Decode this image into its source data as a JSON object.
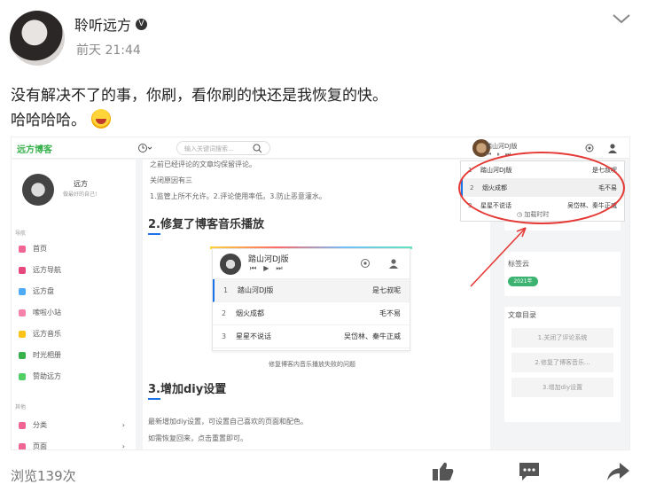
{
  "post": {
    "username": "聆听远方",
    "verified_glyph": "V",
    "time": "前天 21:44",
    "text_line1": "没有解决不了的事，你刷，看你刷的快还是我恢复的快。",
    "text_line2": "哈哈哈哈。",
    "views": "浏览139次",
    "icons": [
      "chevron-down-icon",
      "thumbs-up-icon",
      "comment-icon",
      "share-icon",
      "laughing-emoji-icon"
    ]
  },
  "shot": {
    "logo": "远方博客",
    "search_placeholder": "输入关键词搜索...",
    "blog_name": "远方",
    "blog_motto": "做最好的自己!",
    "nav_header": "导航",
    "nav": [
      "首页",
      "远方导航",
      "远方盘",
      "嗦啦小站",
      "远方音乐",
      "时光相册",
      "赞助远方"
    ],
    "nav_colors": [
      "#f06595",
      "#e64980",
      "#4dabf7",
      "#f783ac",
      "#fcc419",
      "#37b24d",
      "#51cf66"
    ],
    "other_header": "其他",
    "other": [
      "分类",
      "页面"
    ],
    "intro_line1": "之前已经评论的文章均保留评论。",
    "intro_line2": "关闭原因有三",
    "intro_line3": "1.监管上所不允许。2.评论使用率低。3.防止恶意灌水。",
    "h2_music": "2.修复了博客音乐播放",
    "h3_diy": "3.增加diy设置",
    "caption": "修复博客内音乐播放失败的问题",
    "diy_line1": "最新增加diy设置，可设置自己喜欢的页面和配色。",
    "diy_line2": "如需恢复回来，点击重置即可。",
    "player_title": "踏山河DJ版",
    "playlist": [
      {
        "n": "1",
        "title": "踏山河DJ版",
        "artist": "是七叔呢"
      },
      {
        "n": "2",
        "title": "烟火成都",
        "artist": "毛不易"
      },
      {
        "n": "3",
        "title": "星星不说话",
        "artist": "吴岱林、秦牛正威"
      }
    ],
    "popup_rows": [
      {
        "n": "1",
        "title": "踏山河DJ版",
        "artist": "是七叔呢"
      },
      {
        "n": "2",
        "title": "烟火成都",
        "artist": "毛不易"
      },
      {
        "n": "3",
        "title": "星星不说话",
        "artist": "吴岱林、秦牛正威"
      }
    ],
    "popup_header": "踏山河DJ版",
    "lyric_toggle": "加载时时",
    "tags_title": "标签云",
    "tag": "2021年",
    "toc_title": "文章目录",
    "toc": [
      "1.关闭了评论系统",
      "2.修复了博客音乐...",
      "3.增加diy设置"
    ]
  },
  "colors": {
    "accent": "#1a73e8",
    "annotation": "#e53935",
    "text": "#222222"
  }
}
